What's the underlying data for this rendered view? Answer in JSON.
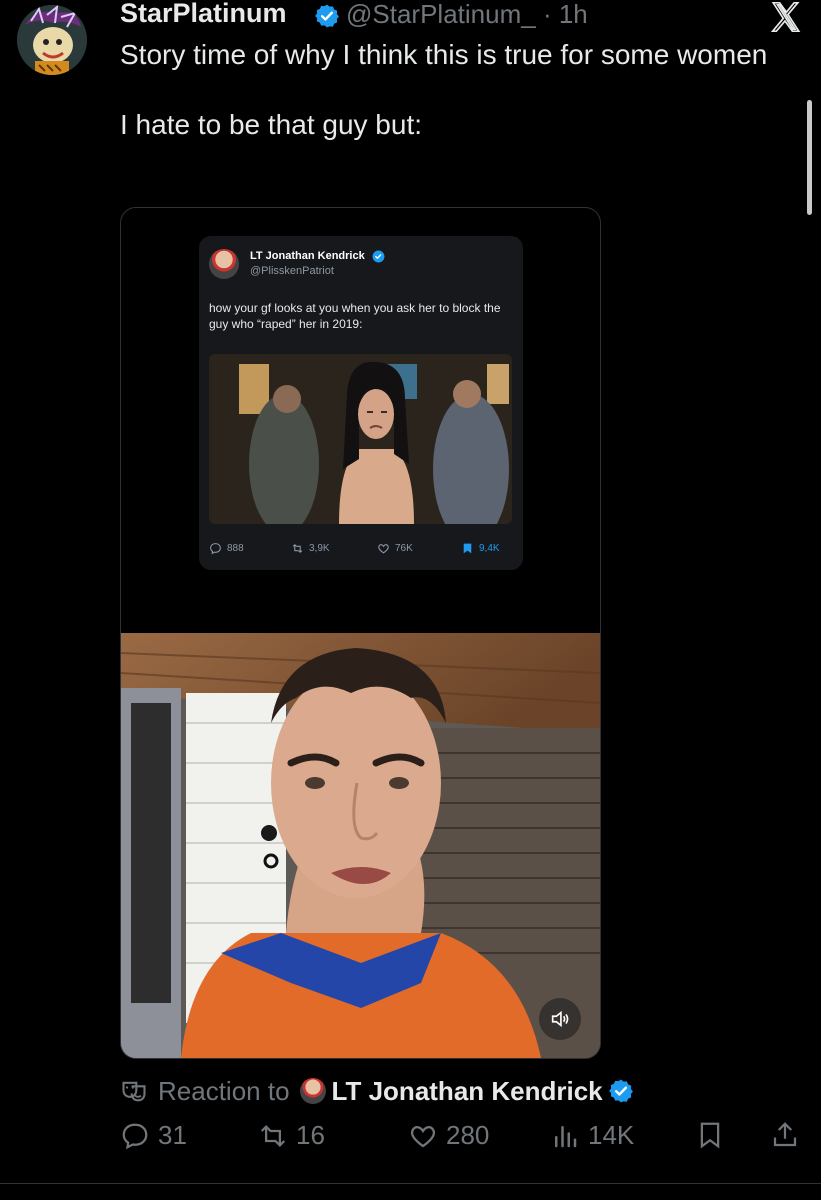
{
  "tweet": {
    "author_name": "StarPlatinum",
    "author_handle": "@StarPlatinum_",
    "separator": "·",
    "time": "1h",
    "text_lines": [
      "Story time of why I think this is true for some women",
      "I hate to be that guy but:"
    ],
    "avatar_icon": "cartoon-avatar",
    "verified_icon": "verified-badge-icon"
  },
  "embedded_tweet": {
    "author_name": "LT Jonathan Kendrick",
    "author_handle": "@PlisskenPatriot",
    "text": "how your gf looks at you when you ask her to block the guy who “raped” her in 2019:",
    "replies": "888",
    "reposts": "3,9K",
    "likes": "76K",
    "bookmarks": "9,4K"
  },
  "reaction": {
    "label": "Reaction to",
    "name": "LT Jonathan Kendrick"
  },
  "actions": {
    "replies": "31",
    "reposts": "16",
    "likes": "280",
    "views": "14K"
  },
  "colors": {
    "background": "#000000",
    "text": "#e7e9ea",
    "muted": "#71767b",
    "verified": "#1d9bf0",
    "bookmark_active": "#1d9bf0"
  }
}
